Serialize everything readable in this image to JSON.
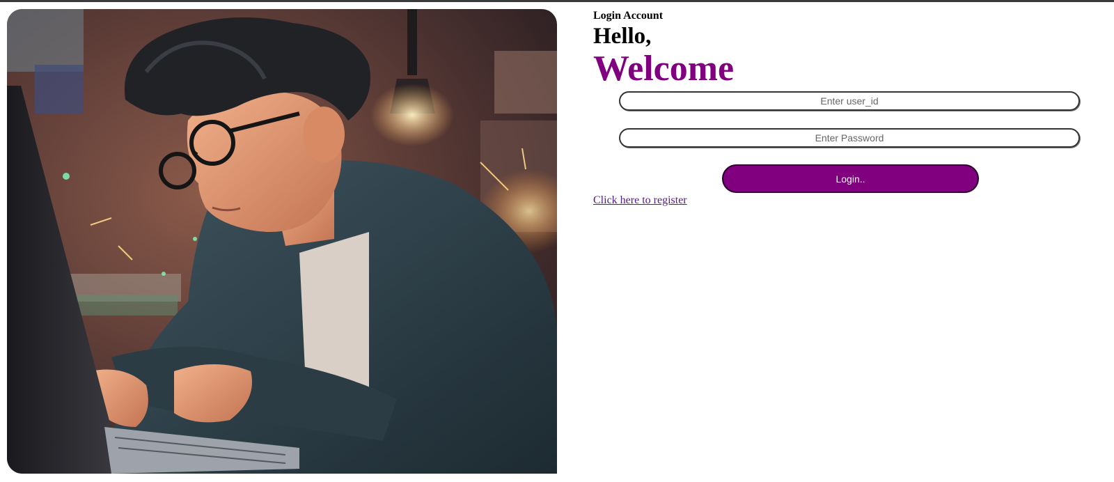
{
  "login": {
    "eyebrow": "Login Account",
    "greeting": "Hello,",
    "welcome": "Welcome",
    "user_id_placeholder": "Enter user_id",
    "password_placeholder": "Enter Password",
    "button_label": "Login..",
    "register_link": "Click here to register"
  },
  "colors": {
    "accent": "#800080",
    "link": "#551a8b"
  },
  "hero_image": {
    "icon": "illustration-boy-with-glasses-at-laptop"
  }
}
